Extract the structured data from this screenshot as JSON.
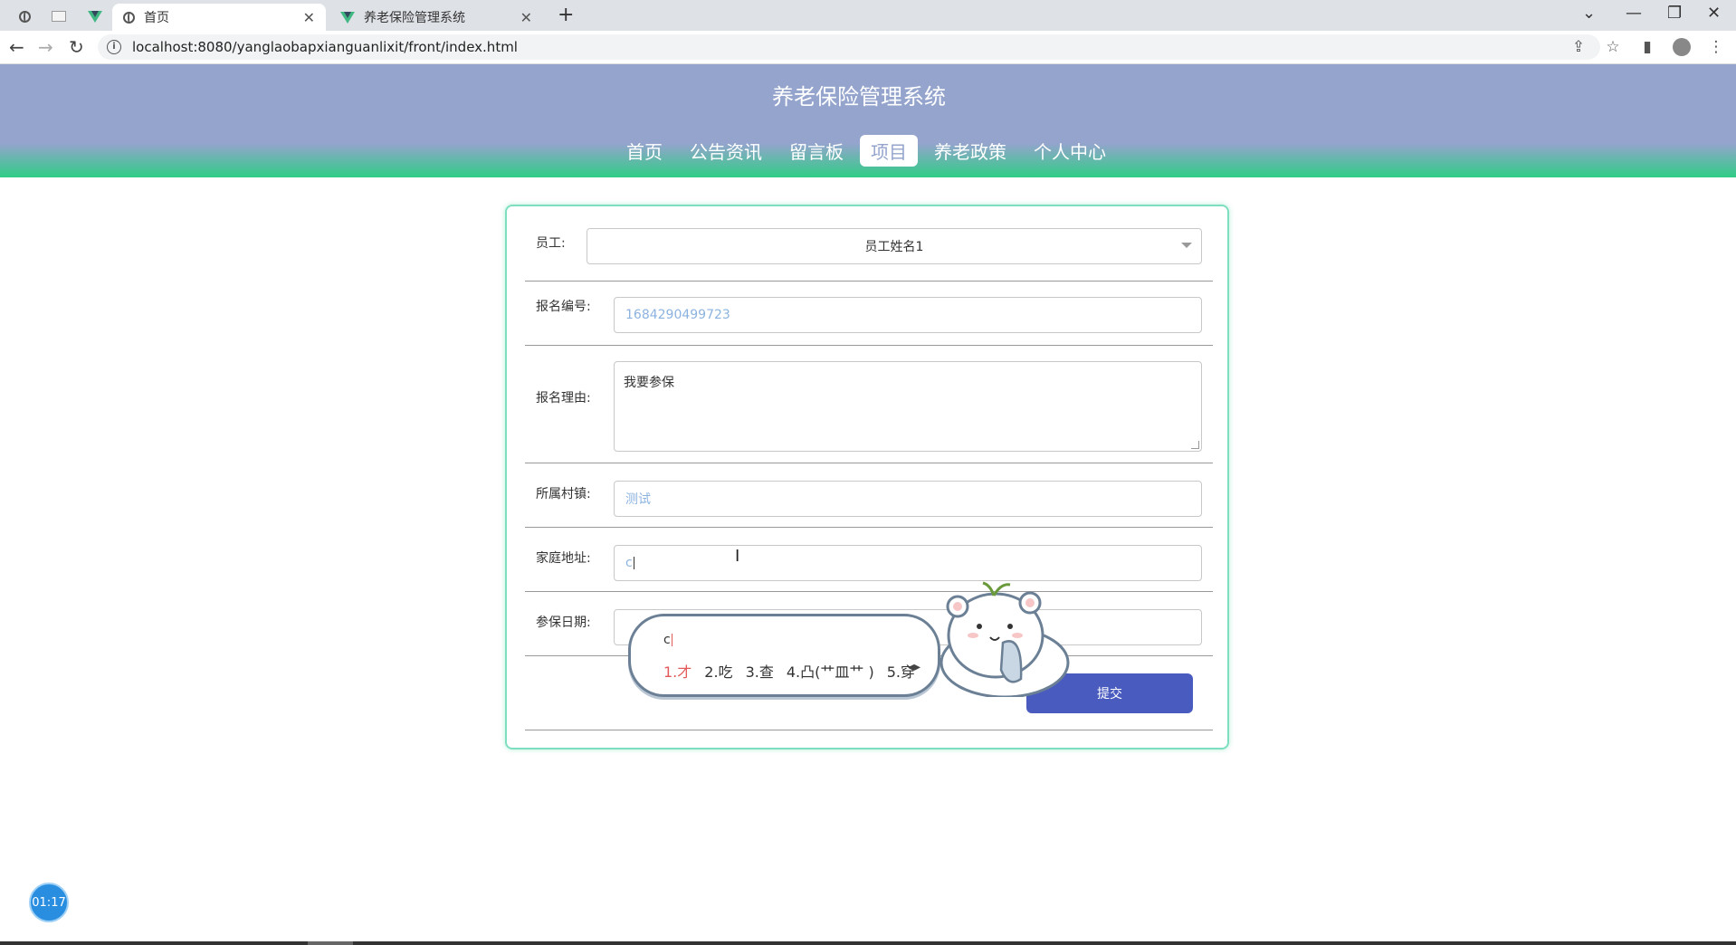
{
  "browser": {
    "tabs": [
      {
        "title": "首页",
        "active": true
      },
      {
        "title": "养老保险管理系统",
        "active": false
      }
    ],
    "url": "localhost:8080/yanglaobapxianguanlixit/front/index.html"
  },
  "site": {
    "title": "养老保险管理系统",
    "nav": [
      "首页",
      "公告资讯",
      "留言板",
      "项目",
      "养老政策",
      "个人中心"
    ],
    "active_nav": "项目"
  },
  "form": {
    "employee": {
      "label": "员工:",
      "value": "员工姓名1"
    },
    "signup_no": {
      "label": "报名编号:",
      "value": "1684290499723"
    },
    "reason": {
      "label": "报名理由:",
      "value": "我要参保"
    },
    "village": {
      "label": "所属村镇:",
      "value": "测试"
    },
    "address": {
      "label": "家庭地址:",
      "value": "c"
    },
    "insure_date": {
      "label": "参保日期:",
      "value": ""
    },
    "submit_label": "提交"
  },
  "ime": {
    "input": "c",
    "candidates": [
      "1.才",
      "2.吃",
      "3.查",
      "4.凸(艹皿艹 )",
      "5.穿"
    ]
  },
  "timer": "01:17",
  "colors": {
    "header_top": "#94a4cd",
    "header_bottom": "#2fcd86",
    "submit": "#4a5bc0",
    "card_border": "#7ddfbf"
  }
}
